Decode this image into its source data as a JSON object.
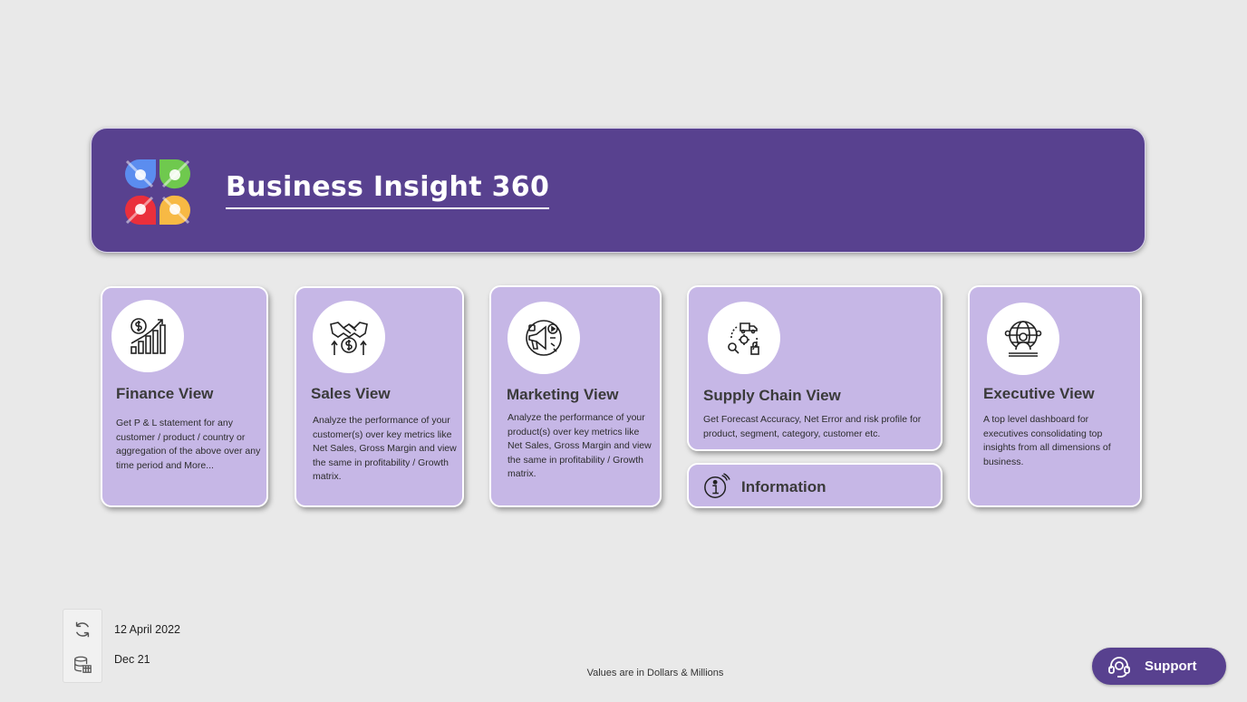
{
  "app": {
    "title": "Business Insight 360"
  },
  "cards": [
    {
      "title": "Finance View",
      "description": "Get P & L statement for any customer / product / country or aggregation of the above over any time period and More...",
      "icon": "finance-chart-icon"
    },
    {
      "title": "Sales View",
      "description": "Analyze the performance of your customer(s) over key metrics like Net Sales, Gross Margin and view the same in profitability / Growth matrix.",
      "icon": "handshake-icon"
    },
    {
      "title": "Marketing View",
      "description": "Analyze the performance of your product(s) over key metrics like Net Sales, Gross Margin and view the same in profitability / Growth matrix.",
      "icon": "megaphone-icon"
    },
    {
      "title": "Supply Chain View",
      "description": "Get Forecast Accuracy, Net Error and risk profile for product, segment, category, customer etc.",
      "icon": "supply-chain-icon"
    },
    {
      "title": "Executive View",
      "description": "A top level dashboard for executives consolidating top insights from all dimensions of business.",
      "icon": "executive-globe-icon"
    }
  ],
  "information": {
    "label": "Information",
    "icon": "info-icon"
  },
  "status": {
    "refresh_date": "12 April 2022",
    "data_period": "Dec 21",
    "refresh_icon": "refresh-icon",
    "data_icon": "database-calendar-icon"
  },
  "footer": {
    "note": "Values are in Dollars & Millions"
  },
  "support": {
    "label": "Support",
    "icon": "headset-icon"
  },
  "colors": {
    "banner": "#58418f",
    "card": "#c6b7e6",
    "background": "#e9e9e9"
  }
}
